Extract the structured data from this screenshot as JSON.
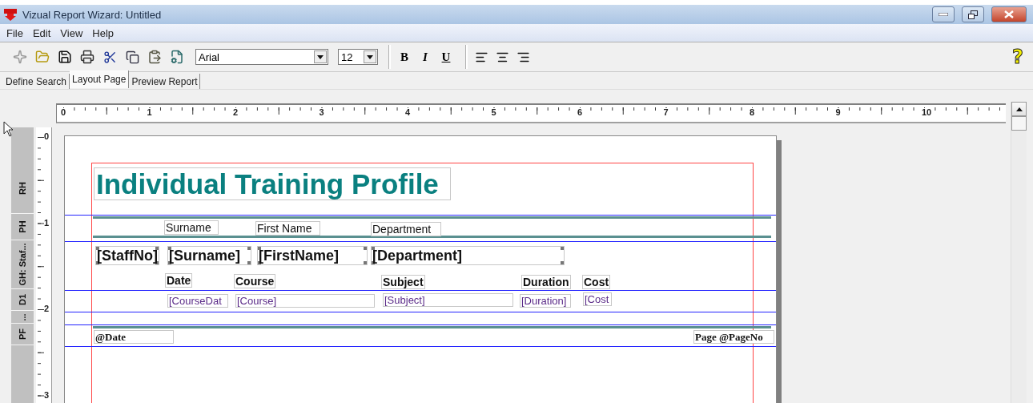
{
  "window": {
    "title": "Vizual Report Wizard: Untitled"
  },
  "menu": [
    "File",
    "Edit",
    "View",
    "Help"
  ],
  "toolbar": {
    "font_name": "Arial",
    "font_size": "12",
    "style_buttons": [
      "B",
      "I",
      "U"
    ],
    "help": "?"
  },
  "tabs": [
    {
      "label": "Define Search",
      "selected": false
    },
    {
      "label": "Layout Page",
      "selected": true
    },
    {
      "label": "Preview Report",
      "selected": false
    }
  ],
  "horizontal_ruler": [
    "0",
    "1",
    "2",
    "3",
    "4",
    "5",
    "6",
    "7",
    "8",
    "9",
    "10"
  ],
  "vertical_ruler": [
    "0",
    "1",
    "2",
    "3"
  ],
  "bands": [
    {
      "label": "RH"
    },
    {
      "label": "PH"
    },
    {
      "label": "GH: Staf..."
    },
    {
      "label": "D1"
    },
    {
      "label": "..."
    },
    {
      "label": "PF"
    }
  ],
  "report_items": [
    {
      "kind": "heading",
      "text": "Individual Training Profile"
    },
    {
      "kind": "header_label",
      "text": "Surname"
    },
    {
      "kind": "header_label",
      "text": "First Name"
    },
    {
      "kind": "header_label",
      "text": "Department"
    },
    {
      "kind": "group_field",
      "text": "[StaffNo]"
    },
    {
      "kind": "group_field",
      "text": "[Surname]"
    },
    {
      "kind": "group_field",
      "text": "[FirstName]"
    },
    {
      "kind": "group_field",
      "text": "[Department]"
    },
    {
      "kind": "detail_label",
      "text": "Date"
    },
    {
      "kind": "detail_label",
      "text": "Course"
    },
    {
      "kind": "detail_label",
      "text": "Subject"
    },
    {
      "kind": "detail_label",
      "text": "Duration"
    },
    {
      "kind": "detail_label",
      "text": "Cost"
    },
    {
      "kind": "detail_field",
      "text": "[CourseDat"
    },
    {
      "kind": "detail_field",
      "text": "[Course]"
    },
    {
      "kind": "detail_field",
      "text": "[Subject]"
    },
    {
      "kind": "detail_field",
      "text": "[Duration]"
    },
    {
      "kind": "detail_field",
      "text": "[Cost"
    },
    {
      "kind": "footer_field",
      "text": "@Date"
    },
    {
      "kind": "footer_field",
      "text": "Page @PageNo"
    }
  ]
}
